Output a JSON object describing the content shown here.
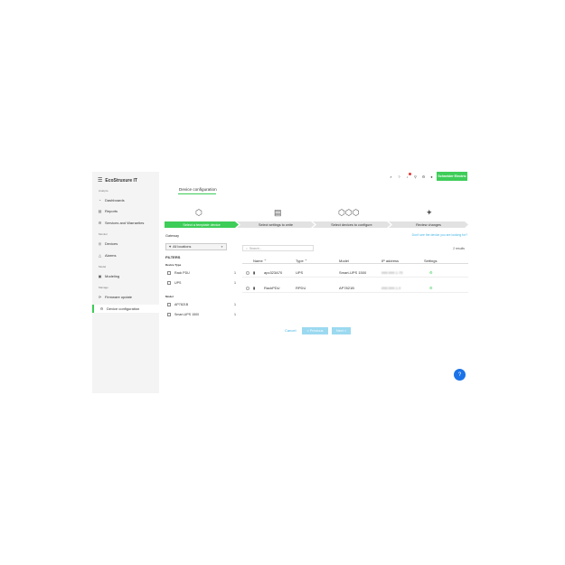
{
  "brand": {
    "name": "EcoStruxure IT"
  },
  "sidebar": {
    "sections": [
      {
        "label": "Analyze"
      },
      {
        "label": "Monitor"
      },
      {
        "label": "Model"
      },
      {
        "label": "Manage"
      }
    ],
    "items": [
      {
        "label": "Dashboards",
        "icon": "dashboard-icon"
      },
      {
        "label": "Reports",
        "icon": "report-icon"
      },
      {
        "label": "Services and Warranties",
        "icon": "services-icon"
      },
      {
        "label": "Devices",
        "icon": "devices-icon"
      },
      {
        "label": "Alarms",
        "icon": "alarm-icon"
      },
      {
        "label": "Modeling",
        "icon": "modeling-icon"
      },
      {
        "label": "Firmware update",
        "icon": "firmware-icon"
      },
      {
        "label": "Device configuration",
        "icon": "config-icon",
        "active": true
      }
    ]
  },
  "header": {
    "logo_text": "Schneider Electric"
  },
  "page": {
    "title": "Device configuration"
  },
  "steps": [
    {
      "label": "Select a template device",
      "active": true,
      "icon": "device-icon"
    },
    {
      "label": "Select settings to write",
      "active": false,
      "icon": "document-icon"
    },
    {
      "label": "Select devices to configure",
      "active": false,
      "icon": "multi-device-icon"
    },
    {
      "label": "Review changes",
      "active": false,
      "icon": "magic-wand-icon"
    }
  ],
  "filters": {
    "gateway_label": "Gateway",
    "location_value": "All locations",
    "title": "FILTERS",
    "device_type_label": "Device Type",
    "device_types": [
      {
        "label": "Rack PDU",
        "count": "1"
      },
      {
        "label": "UPS",
        "count": "1"
      }
    ],
    "model_label": "Model",
    "models": [
      {
        "label": "AP7821B",
        "count": "1"
      },
      {
        "label": "Smart-UPS 1500",
        "count": "1"
      }
    ]
  },
  "table": {
    "help_link": "Don't see the device you are looking for?",
    "search_placeholder": "Search...",
    "results": "2 results",
    "columns": [
      "Name",
      "Type",
      "Model",
      "IP address",
      "Settings"
    ],
    "rows": [
      {
        "name": "apc323A70",
        "type": "UPS",
        "model": "Smart-UPS 1500",
        "ip": "###.###.1.75"
      },
      {
        "name": "RackPDU",
        "type": "RPDU",
        "model": "AP7821B",
        "ip": "###.###.1.9"
      }
    ]
  },
  "actions": {
    "cancel": "Cancel",
    "previous": "< Previous",
    "next": "Next >"
  },
  "colors": {
    "accent": "#3dcd58",
    "link": "#42b4e6",
    "fab": "#1a73e8"
  }
}
